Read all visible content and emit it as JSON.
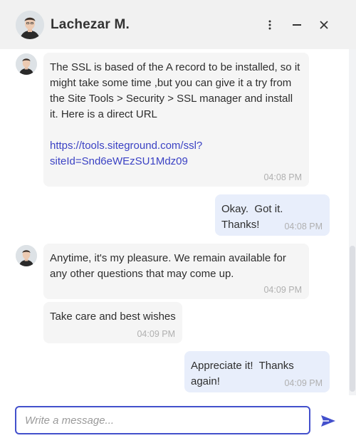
{
  "header": {
    "agent_name": "Lachezar M.",
    "icons": [
      "more-vertical-icon",
      "minimize-icon",
      "close-icon"
    ]
  },
  "colors": {
    "accent": "#4350cc",
    "link": "#3b42c4",
    "agent_bubble": "#f5f5f5",
    "user_bubble": "#e8eefb",
    "header_bg": "#f1f1f1"
  },
  "messages": [
    {
      "from": "agent",
      "text": "The SSL is based of the A record to be installed, so it might take some time ,but you can give it a try from the Site Tools > Security > SSL manager and install it. Here is a direct URL",
      "link": "https://tools.siteground.com/ssl?siteId=Snd6eWEzSU1Mdz09",
      "link_line1": "https://tools.siteground.com/ssl?",
      "link_line2": "siteId=Snd6eWEzSU1Mdz09",
      "time": "04:08 PM"
    },
    {
      "from": "user",
      "text": "Okay.  Got it.  Thanks!",
      "time": "04:08 PM"
    },
    {
      "from": "agent",
      "text": "Anytime, it's my pleasure. We remain available for any other questions that may come up.",
      "time": "04:09 PM"
    },
    {
      "from": "agent",
      "text": "Take care and best wishes",
      "time": "04:09 PM"
    },
    {
      "from": "user",
      "text": "Appreciate it!  Thanks again!",
      "time": "04:09 PM"
    }
  ],
  "composer": {
    "placeholder": "Write a message...",
    "value": ""
  }
}
